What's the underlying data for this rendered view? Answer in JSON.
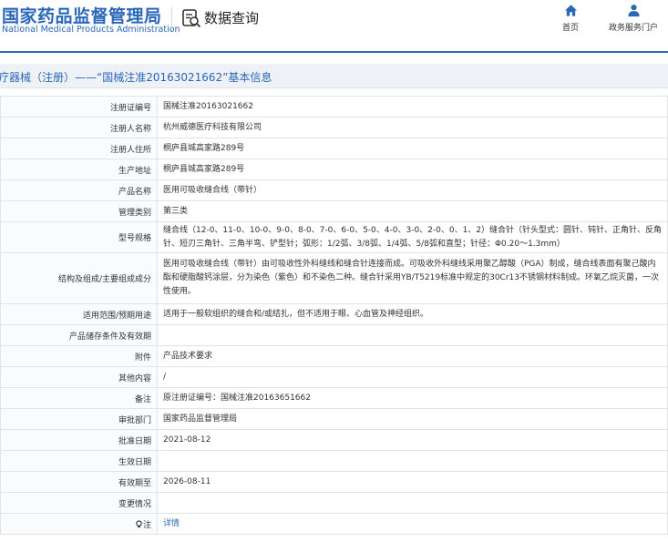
{
  "header": {
    "logo_cn": "国家药品监督管理局",
    "logo_en": "National Medical Products Administration",
    "query_title": "数据查询",
    "nav": [
      {
        "label": "首页",
        "icon": "home-icon"
      },
      {
        "label": "政务服务门户",
        "icon": "user-icon"
      }
    ]
  },
  "section": {
    "title": "疗器械（注册）——“国械注准20163021662”基本信息"
  },
  "rows": [
    {
      "label": "注册证编号",
      "value": "国械注准20163021662"
    },
    {
      "label": "注册人名称",
      "value": "杭州威德医疗科技有限公司"
    },
    {
      "label": "注册人住所",
      "value": "桐庐县城高家路289号"
    },
    {
      "label": "生产地址",
      "value": "桐庐县城高家路289号"
    },
    {
      "label": "产品名称",
      "value": "医用可吸收缝合线（带针）"
    },
    {
      "label": "管理类别",
      "value": "第三类"
    },
    {
      "label": "型号规格",
      "value": "缝合线（12-0、11-0、10-0、9-0、8-0、7-0、6-0、5-0、4-0、3-0、2-0、0、1、2）缝合针（针头型式：圆针、钝针、正角针、反角针、短刃三角针、三角半弯、铲型针；弧形：1/2弧、3/8弧、1/4弧、5/8弧和直型；针径：Φ0.20～1.3mm）"
    },
    {
      "label": "结构及组成/主要组成成分",
      "value": "医用可吸收缝合线（带针）由可吸收性外科缝线和缝合针连接而成。可吸收外科缝线采用聚乙醇酸（PGA）制成，缝合线表面有聚己酸内酯和硬脂酸钙涂层，分为染色（紫色）和不染色二种。缝合针采用YB/T5219标准中规定的30Cr13不锈钢材料制成。环氧乙烷灭菌，一次性使用。"
    },
    {
      "label": "适用范围/预期用途",
      "value": "适用于一般软组织的缝合和/或结扎，但不适用于眼、心血管及神经组织。"
    },
    {
      "label": "产品储存条件及有效期",
      "value": ""
    },
    {
      "label": "附件",
      "value": "产品技术要求"
    },
    {
      "label": "其他内容",
      "value": "/"
    },
    {
      "label": "备注",
      "value": "原注册证编号：国械注准20163651662"
    },
    {
      "label": "审批部门",
      "value": "国家药品监督管理局"
    },
    {
      "label": "批准日期",
      "value": "2021-08-12"
    },
    {
      "label": "生效日期",
      "value": ""
    },
    {
      "label": "有效期至",
      "value": "2026-08-11"
    },
    {
      "label": "变更情况",
      "value": ""
    },
    {
      "label": "注",
      "value": "详情"
    }
  ],
  "colors": {
    "brand_blue": "#2a67b7",
    "section_bg": "#eef2f7",
    "border": "#dfe4ea"
  }
}
